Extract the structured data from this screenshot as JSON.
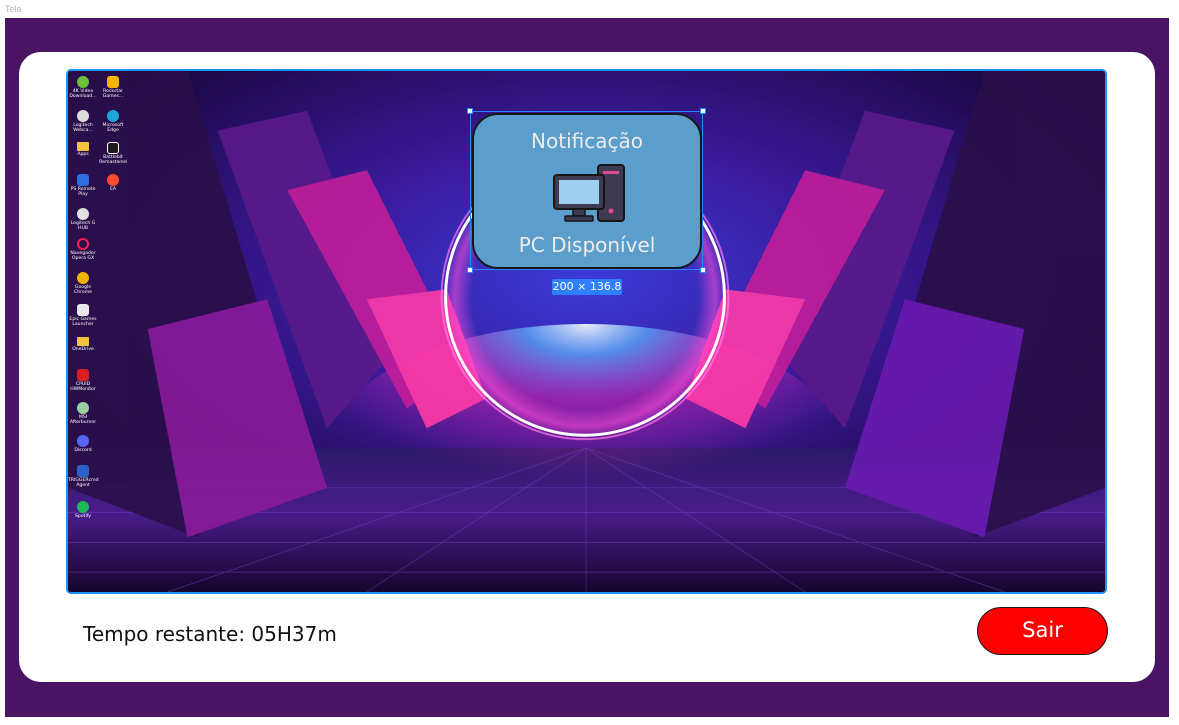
{
  "frame_label": "Tela",
  "desktop_icons": [
    {
      "label": "4K Video Download...",
      "icon": "downloader-icon",
      "color": "#6bbf3a"
    },
    {
      "label": "Rockstar Games...",
      "icon": "rockstar-icon",
      "color": "#f5b400"
    },
    {
      "label": "Logitech Webca...",
      "icon": "webcam-icon",
      "color": "#dcdcdc"
    },
    {
      "label": "Microsoft Edge",
      "icon": "edge-icon",
      "color": "#1ea7d6"
    },
    {
      "label": "Apps",
      "icon": "folder-icon",
      "color": "#f3c241"
    },
    {
      "label": "Battlebit Remastered",
      "icon": "battlebit-icon",
      "color": "#1c1c1c"
    },
    {
      "label": "PS Remote Play",
      "icon": "ps-remote-icon",
      "color": "#2d6ee0"
    },
    {
      "label": "EA",
      "icon": "ea-icon",
      "color": "#ff4a2f"
    },
    {
      "label": "Logitech G HUB",
      "icon": "ghub-icon",
      "color": "#e0e0e0"
    },
    {
      "label": "Navegador Opera GX",
      "icon": "opera-gx-icon",
      "color": "#ff1e4f"
    },
    {
      "label": "Google Chrome",
      "icon": "chrome-icon",
      "color": "#f2b300"
    },
    {
      "label": "Epic Games Launcher",
      "icon": "epic-games-icon",
      "color": "#e8e8e8"
    },
    {
      "label": "OneDrive",
      "icon": "folder-icon",
      "color": "#f3c241"
    },
    {
      "label": "CPUID HWMonitor",
      "icon": "hwmonitor-icon",
      "color": "#d81e1e"
    },
    {
      "label": "MSI Afterburner",
      "icon": "afterburner-icon",
      "color": "#9ad0a0"
    },
    {
      "label": "Discord",
      "icon": "discord-icon",
      "color": "#5865f2"
    },
    {
      "label": "TRIGGERcmd Agent",
      "icon": "triggercmd-icon",
      "color": "#2a62c9"
    },
    {
      "label": "Spotify",
      "icon": "spotify-icon",
      "color": "#1db954"
    }
  ],
  "notification": {
    "title": "Notificação",
    "message": "PC Disponível",
    "icon": "desktop-computer-icon"
  },
  "selection": {
    "dimensions": "200 × 136.8"
  },
  "footer": {
    "timer": "Tempo restante: 05H37m",
    "exit_label": "Sair"
  },
  "colors": {
    "frame": "#4a1464",
    "selection": "#2f80ff",
    "notification_bg": "#5b9dcb",
    "exit_button": "#ff0000"
  }
}
